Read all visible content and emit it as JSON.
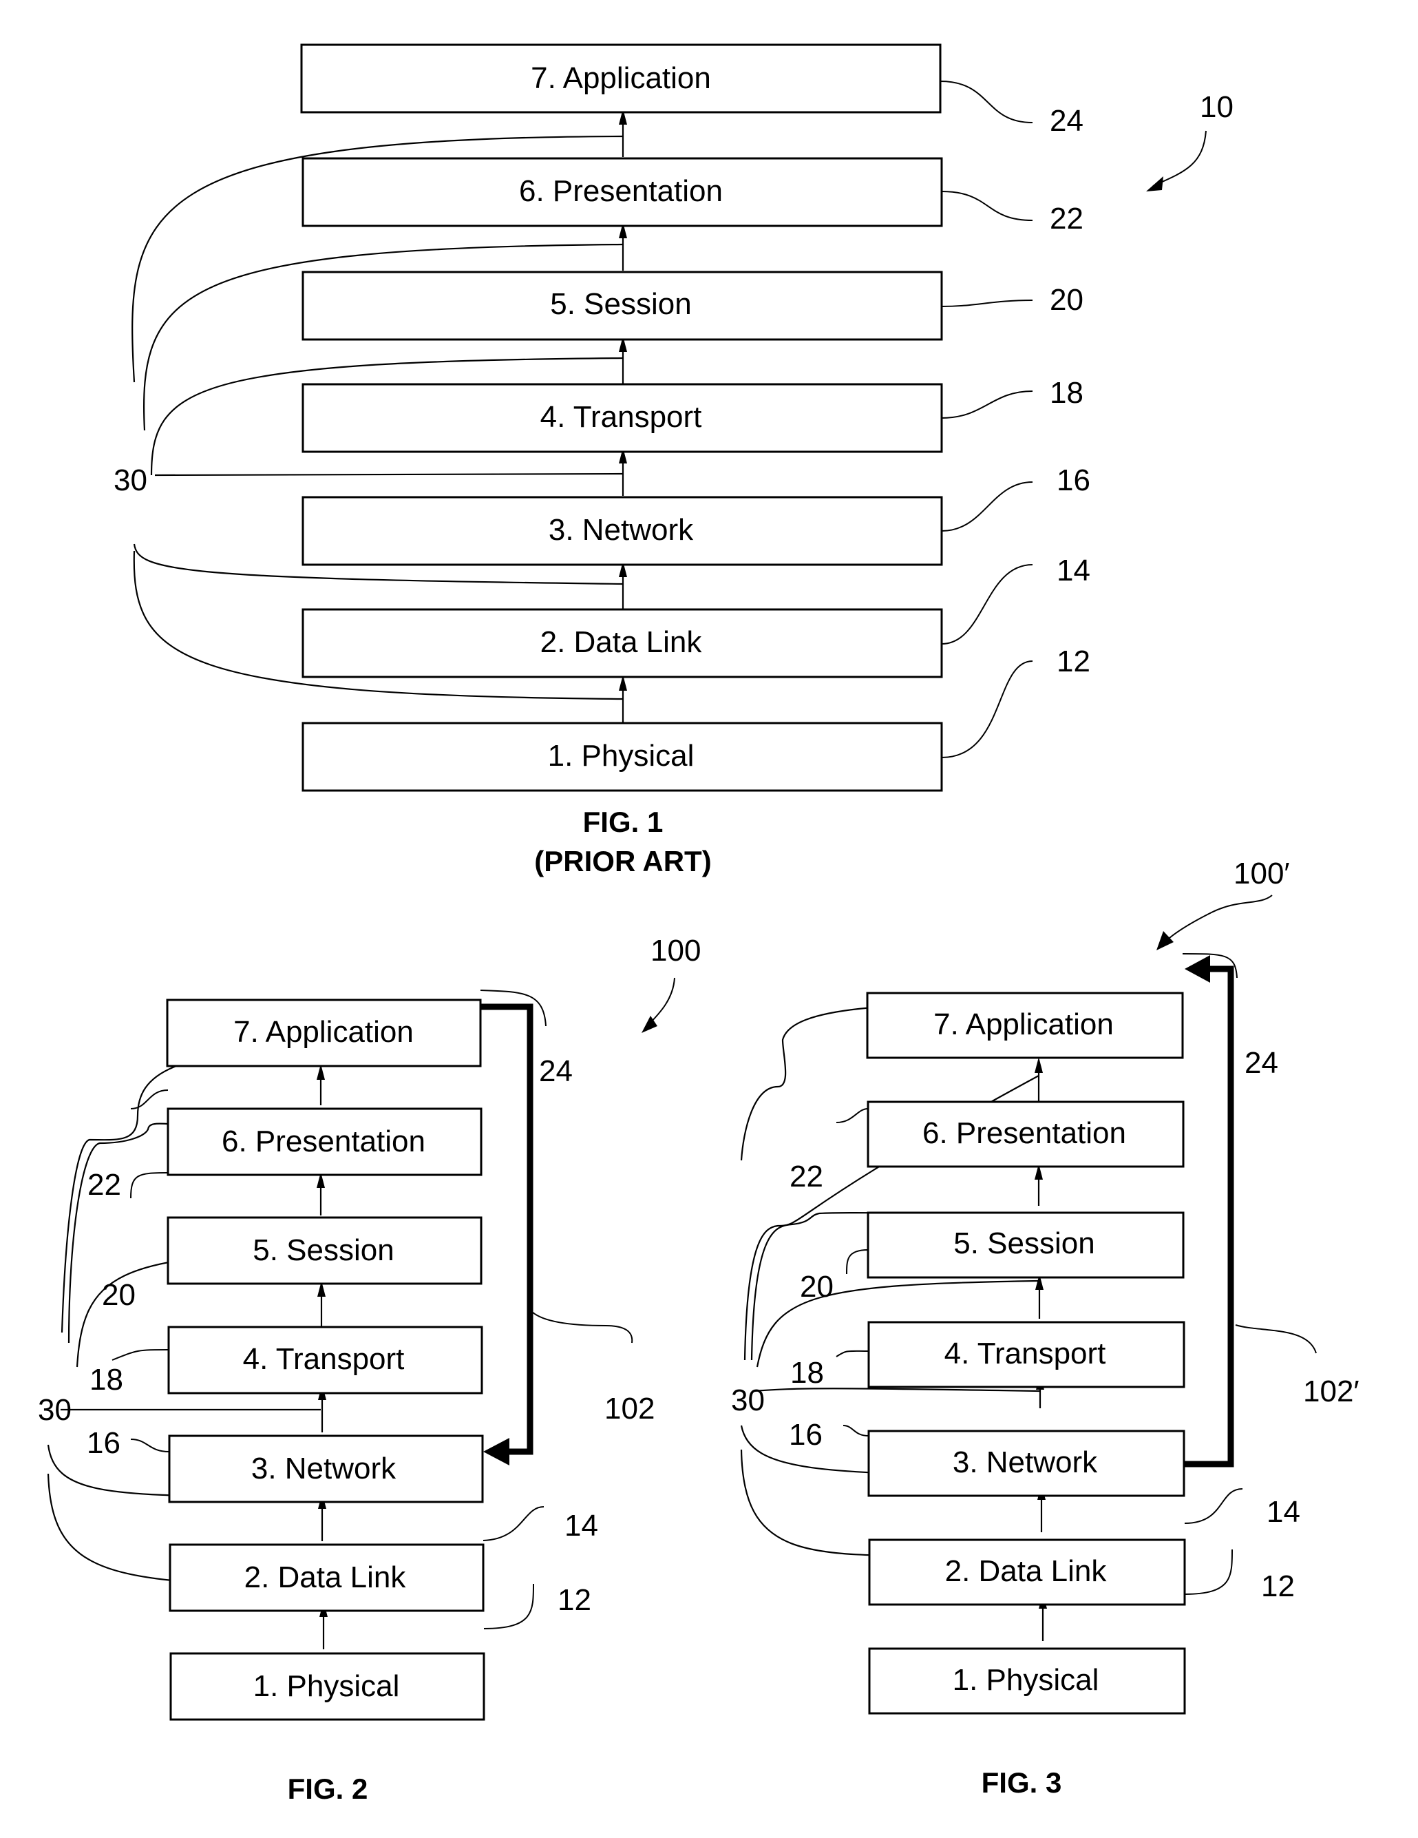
{
  "figures": [
    {
      "id": "fig1",
      "caption": "FIG. 1",
      "subcaption": "(PRIOR ART)",
      "assembly_ref": "10",
      "bus_ref": "30",
      "layers": [
        {
          "label": "7.  Application",
          "ref": "24"
        },
        {
          "label": "6.  Presentation",
          "ref": "22"
        },
        {
          "label": "5.  Session",
          "ref": "20"
        },
        {
          "label": "4.  Transport",
          "ref": "18"
        },
        {
          "label": "3.  Network",
          "ref": "16"
        },
        {
          "label": "2.  Data Link",
          "ref": "14"
        },
        {
          "label": "1.  Physical",
          "ref": "12"
        }
      ]
    },
    {
      "id": "fig2",
      "caption": "FIG. 2",
      "assembly_ref": "100",
      "bus_ref": "30",
      "bypass_ref": "102",
      "bypass_direction": "Application to Network",
      "layers": [
        {
          "label": "7.  Application",
          "ref": "24"
        },
        {
          "label": "6.  Presentation",
          "ref": "22"
        },
        {
          "label": "5.  Session",
          "ref": "20"
        },
        {
          "label": "4.  Transport",
          "ref": "18"
        },
        {
          "label": "3.  Network",
          "ref": "16"
        },
        {
          "label": "2.  Data Link",
          "ref": "14"
        },
        {
          "label": "1.  Physical",
          "ref": "12"
        }
      ]
    },
    {
      "id": "fig3",
      "caption": "FIG. 3",
      "assembly_ref": "100′",
      "bus_ref": "30",
      "bypass_ref": "102′",
      "bypass_direction": "Network to Application",
      "layers": [
        {
          "label": "7.  Application",
          "ref": "24"
        },
        {
          "label": "6.  Presentation",
          "ref": "22"
        },
        {
          "label": "5.  Session",
          "ref": "20"
        },
        {
          "label": "4.  Transport",
          "ref": "18"
        },
        {
          "label": "3.  Network",
          "ref": "16"
        },
        {
          "label": "2.  Data Link",
          "ref": "14"
        },
        {
          "label": "1.  Physical",
          "ref": "12"
        }
      ]
    }
  ]
}
